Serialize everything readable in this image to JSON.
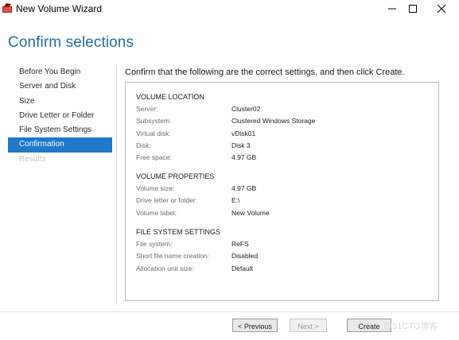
{
  "window": {
    "title": "New Volume Wizard",
    "icon": "wizard-app-icon",
    "controls": [
      "minimize-icon",
      "maximize-icon",
      "close-icon"
    ]
  },
  "page_title": "Confirm selections",
  "nav": {
    "items": [
      {
        "label": "Before You Begin",
        "state": "normal"
      },
      {
        "label": "Server and Disk",
        "state": "normal"
      },
      {
        "label": "Size",
        "state": "normal"
      },
      {
        "label": "Drive Letter or Folder",
        "state": "normal"
      },
      {
        "label": "File System Settings",
        "state": "normal"
      },
      {
        "label": "Confirmation",
        "state": "active"
      },
      {
        "label": "Results",
        "state": "disabled"
      }
    ]
  },
  "instruction": "Confirm that the following are the correct settings, and then click Create.",
  "sections": [
    {
      "heading": "VOLUME LOCATION",
      "rows": [
        {
          "label": "Server:",
          "value": "Cluster02"
        },
        {
          "label": "Subsystem:",
          "value": "Clustered Windows Storage"
        },
        {
          "label": "Virtual disk:",
          "value": "vDisk01"
        },
        {
          "label": "Disk:",
          "value": "Disk 3"
        },
        {
          "label": "Free space:",
          "value": "4.97 GB"
        }
      ]
    },
    {
      "heading": "VOLUME PROPERTIES",
      "rows": [
        {
          "label": "Volume size:",
          "value": "4.97 GB"
        },
        {
          "label": "Drive letter or folder:",
          "value": "E:\\"
        },
        {
          "label": "Volume label:",
          "value": "New Volume"
        }
      ]
    },
    {
      "heading": "FILE SYSTEM SETTINGS",
      "rows": [
        {
          "label": "File system:",
          "value": "ReFS"
        },
        {
          "label": "Short file name creation:",
          "value": "Disabled"
        },
        {
          "label": "Allocation unit size:",
          "value": "Default"
        }
      ]
    }
  ],
  "buttons": {
    "previous": "< Previous",
    "next": "Next >",
    "create": "Create"
  },
  "watermark": "@51CTO博客",
  "colors": {
    "title_blue": "#1f6ea0",
    "nav_active": "#1f78c8"
  }
}
